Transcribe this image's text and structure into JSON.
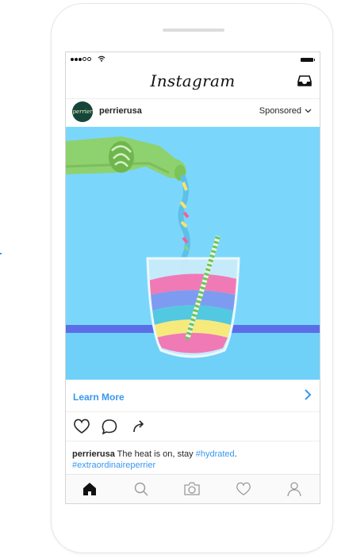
{
  "header": {
    "logo": "Instagram"
  },
  "post": {
    "username": "perrierusa",
    "avatar_text": "perrier",
    "sponsored_label": "Sponsored",
    "cta_label": "Learn More",
    "caption": {
      "username": "perrierusa",
      "text": " The heat is on, stay ",
      "hashtag1": "#hydrated",
      "after": ".",
      "hashtag2": "#extraordinaireperrier"
    }
  },
  "colors": {
    "accent": "#3897f0",
    "media_bg": "#7ad7fb",
    "bottle": "#8ed16f",
    "table": "#5b6ee8",
    "table_top": "#6fd0f8"
  },
  "icons": [
    "signal-icon",
    "wifi-icon",
    "battery-icon",
    "inbox-icon",
    "chevron-down-icon",
    "chevron-right-icon",
    "heart-icon",
    "comment-icon",
    "share-icon",
    "home-icon",
    "search-icon",
    "camera-icon",
    "activity-heart-icon",
    "profile-icon"
  ]
}
